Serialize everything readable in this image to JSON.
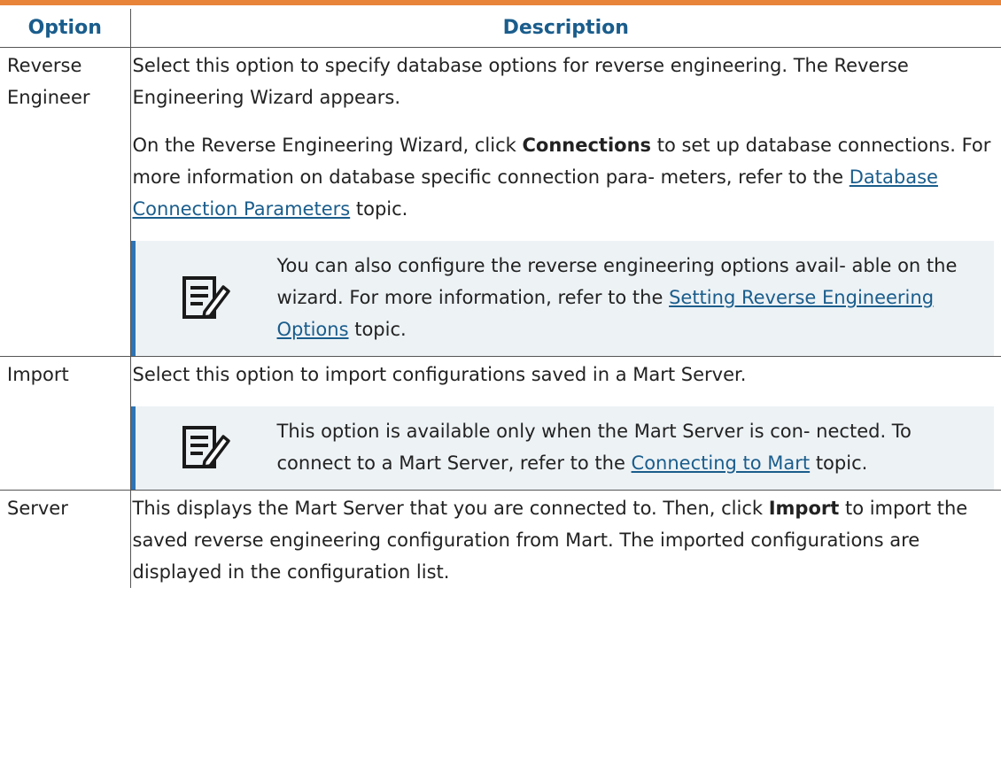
{
  "header": {
    "col_option": "Option",
    "col_description": "Description"
  },
  "rows": [
    {
      "option": "Reverse Engineer",
      "p1": "Select this option to specify database options for reverse engineering. The Reverse Engineering Wizard appears.",
      "p2_pre": "On the Reverse Engineering Wizard, click ",
      "p2_bold": "Connections",
      "p2_mid": " to set up database connections. For more information on database specific connection para- meters, refer to the ",
      "p2_link": "Database Connection Parameters",
      "p2_post": " topic.",
      "note_pre": "You can also configure the reverse engineering options avail- able on the wizard. For more information, refer to the ",
      "note_link": "Setting Reverse Engineering Options",
      "note_post": " topic.",
      "note_icon": "note-edit-icon"
    },
    {
      "option": "Import",
      "p1": "Select this option to import configurations saved in a Mart Server.",
      "note_pre": "This option is available only when the Mart Server is con- nected. To connect to a Mart Server, refer to the ",
      "note_link": "Connecting to Mart",
      "note_post": " topic.",
      "note_icon": "note-edit-icon"
    },
    {
      "option": "Server",
      "p1_pre": "This displays the Mart Server that you are connected to. Then, click ",
      "p1_bold": "Import",
      "p1_post": " to import the saved reverse engineering configuration from Mart. The imported configurations are displayed in the configuration list."
    }
  ],
  "colors": {
    "accent_bar": "#e8833a",
    "header_text": "#1a5d8c",
    "note_border": "#2e74b5",
    "note_bg": "#edf2f5"
  }
}
